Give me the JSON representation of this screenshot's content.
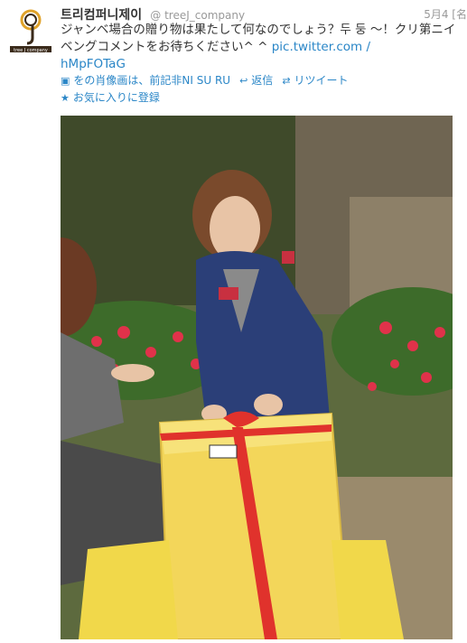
{
  "tweet": {
    "display_name": "트리컴퍼니제이",
    "screen_name": "@ treeJ_company",
    "timestamp": "5月4 [名",
    "text_main": "ジャンベ場合の贈り物は果たして何なのでしょう？두 둥 ～！クリ第ニイベングコメントをお待ちください^ ^ ",
    "link_line1": "pic.twitter.com /",
    "link_line2": "hMpFOTaG"
  },
  "avatar": {
    "icon": "treej-company-logo",
    "caption": "tree J company"
  },
  "actions": [
    {
      "icon": "media-icon",
      "label": "をの肖像画は、前記非NI SU RU"
    },
    {
      "icon": "reply-icon",
      "label": "返信"
    },
    {
      "icon": "retweet-icon",
      "label": "リツイート"
    },
    {
      "icon": "favorite-star-icon",
      "label": "お気に入りに登録"
    }
  ],
  "colors": {
    "link": "#2a86c7",
    "box": "#f3d65a",
    "ribbon": "#e0322c",
    "jacket": "#2b3f78"
  }
}
